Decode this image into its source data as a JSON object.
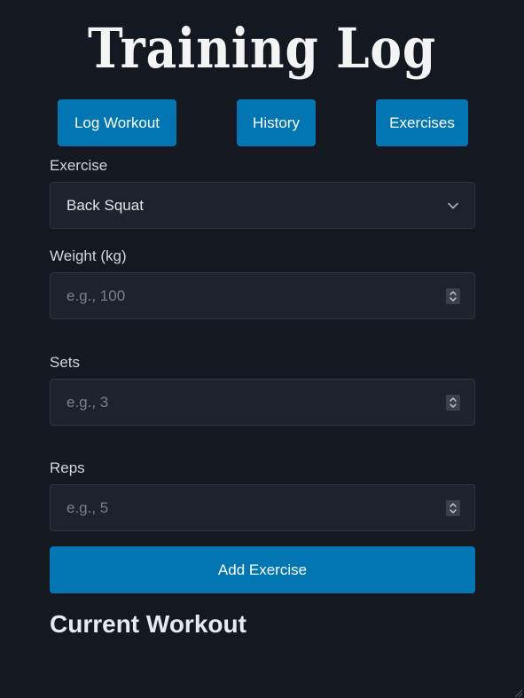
{
  "app": {
    "title": "Training Log"
  },
  "nav": {
    "items": [
      {
        "label": "Log Workout"
      },
      {
        "label": "History"
      },
      {
        "label": "Exercises"
      }
    ]
  },
  "form": {
    "exercise": {
      "label": "Exercise",
      "selected": "Back Squat"
    },
    "weight": {
      "label": "Weight (kg)",
      "placeholder": "e.g., 100",
      "value": ""
    },
    "sets": {
      "label": "Sets",
      "placeholder": "e.g., 3",
      "value": ""
    },
    "reps": {
      "label": "Reps",
      "placeholder": "e.g., 5",
      "value": ""
    },
    "submit_label": "Add Exercise"
  },
  "current_workout": {
    "title": "Current Workout"
  },
  "colors": {
    "background": "#141820",
    "accent": "#0176b3",
    "field_bg": "#1e222c"
  }
}
